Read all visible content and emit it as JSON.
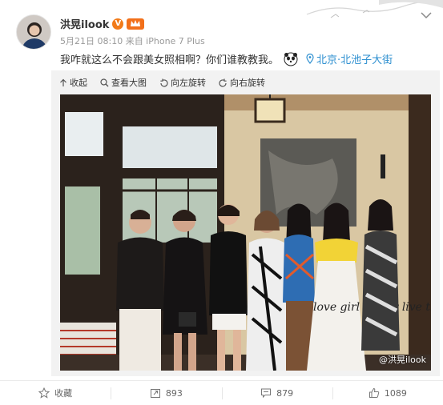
{
  "post": {
    "username": "洪晃ilook",
    "verified_mark": "V",
    "vip_badge": "",
    "meta": "5月21日 08:10 来自 iPhone 7 Plus",
    "text": "我咋就这么不会跟美女照相啊？你们谁教教我。",
    "location": "北京·北池子大街"
  },
  "media_actions": {
    "collapse": "收起",
    "view_large": "查看大图",
    "rotate_left": "向左旋转",
    "rotate_right": "向右旋转"
  },
  "photo": {
    "watermark": "@洪晃ilook",
    "dress_text": "love girl writer live the many"
  },
  "footer": {
    "favorite": "收藏",
    "repost_count": "893",
    "comment_count": "879",
    "like_count": "1089"
  },
  "colors": {
    "link": "#2d8fd0",
    "vip": "#f27b1a",
    "muted": "#999999"
  }
}
